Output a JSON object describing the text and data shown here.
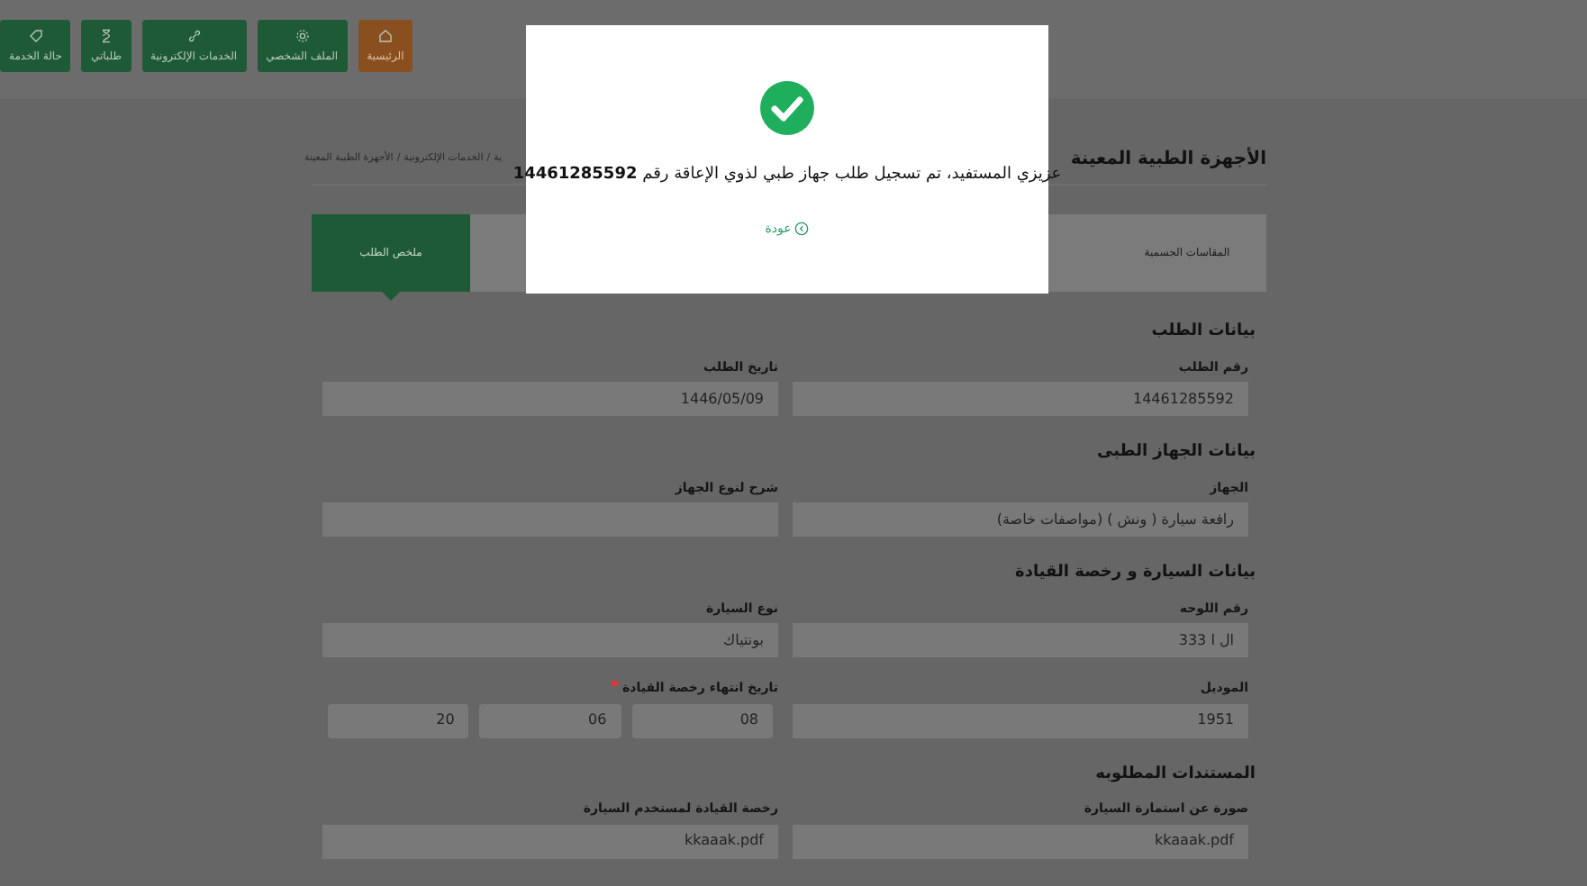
{
  "nav": [
    {
      "label": "الرئيسية",
      "kind": "home",
      "selected": true
    },
    {
      "label": "الملف الشخصي",
      "kind": "gear",
      "selected": false
    },
    {
      "label": "الخدمات الإلكترونية",
      "kind": "link",
      "selected": false
    },
    {
      "label": "طلباتي",
      "kind": "hourglass",
      "selected": false
    },
    {
      "label": "حالة الخدمة",
      "kind": "tag",
      "selected": false
    }
  ],
  "page_title": "الأجهزة الطبية المعينة",
  "breadcrumb": [
    "ية",
    "الخدمات الإلكترونية",
    "الأجهزة الطبية المعينة"
  ],
  "breadcrumb_separators": [
    "/",
    "/"
  ],
  "steps": [
    {
      "label": "المقاسات الجسمية",
      "selected": false
    },
    {
      "label": "ملخص الطلب",
      "selected": true
    }
  ],
  "sections": [
    {
      "title": "بيانات الطلب",
      "rows": [
        [
          {
            "label": "رقم الطلب",
            "value": "14461285592"
          },
          {
            "label": "تاريخ الطلب",
            "value": "1446/05/09"
          }
        ]
      ]
    },
    {
      "title": "بيانات الجهاز الطبى",
      "rows": [
        [
          {
            "label": "الجهاز",
            "value": "رافعة سيارة ( ونش ) (مواصفات خاصة)"
          },
          {
            "label": "شرح لنوع الجهاز"
          }
        ]
      ]
    },
    {
      "title": "بيانات السيارة و رخصة القيادة",
      "rows": [
        [
          {
            "label": "رقم اللوحه",
            "value": "ال ا 333"
          },
          {
            "label": "نوع السيارة",
            "value": "بونتياك"
          }
        ],
        [
          {
            "label": "الموديل",
            "value": "1951"
          },
          {
            "label": "تاريخ انتهاء رخصة القيادة",
            "required_mark": "*",
            "parts": [
              "08",
              "06",
              "20"
            ]
          }
        ]
      ]
    },
    {
      "title": "المستندات المطلوبه",
      "rows": [
        [
          {
            "label": "صورة عن استمارة السيارة",
            "value": "kkaaak.pdf"
          },
          {
            "label": "رخصة القيادة لمستخدم السيارة",
            "value": "kkaaak.pdf"
          }
        ]
      ]
    }
  ],
  "dialog": {
    "message": "عزيزي المستفيد، تم تسجيل طلب جهاز طبي لذوي الإعاقة رقم **14461285592**",
    "link": "عودة"
  }
}
